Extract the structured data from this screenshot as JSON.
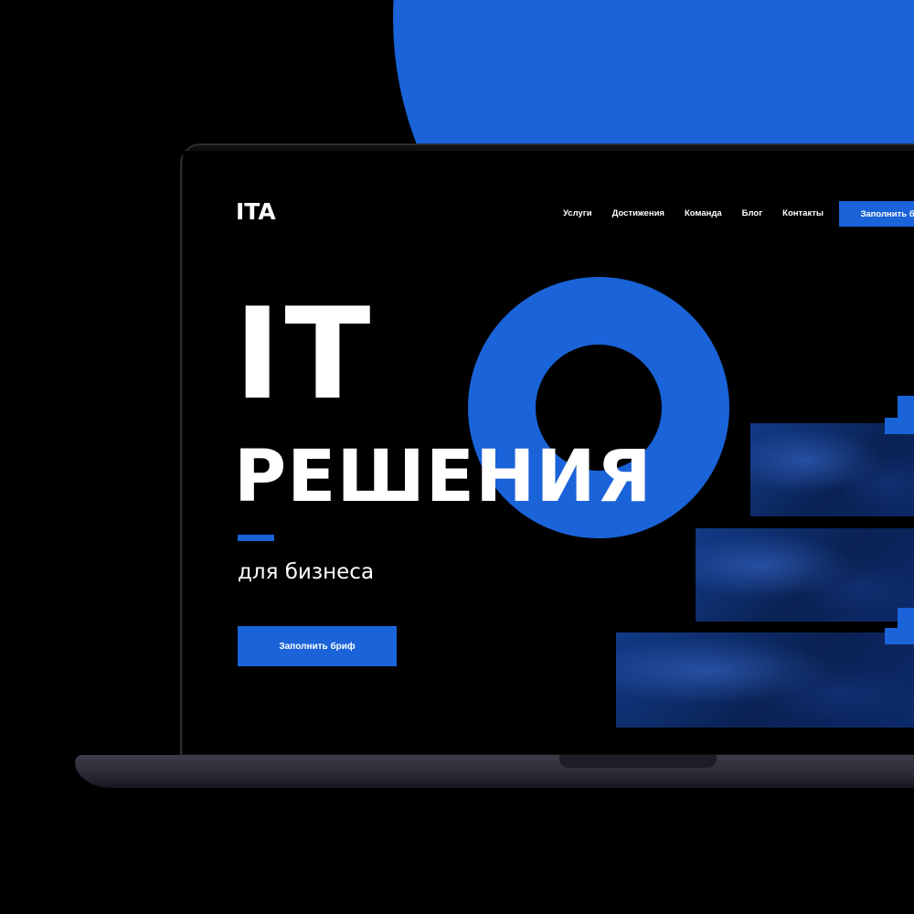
{
  "header": {
    "logo": "ITA",
    "nav": [
      "Услуги",
      "Достижения",
      "Команда",
      "Блог",
      "Контакты"
    ],
    "cta_label": "Заполнить бриф"
  },
  "hero": {
    "title_line1": "IT",
    "title_line2": "РЕШЕНИЯ",
    "subtitle": "для бизнеса",
    "cta_label": "Заполнить бриф"
  },
  "colors": {
    "accent": "#1a63d8",
    "background": "#000000",
    "text": "#ffffff"
  }
}
